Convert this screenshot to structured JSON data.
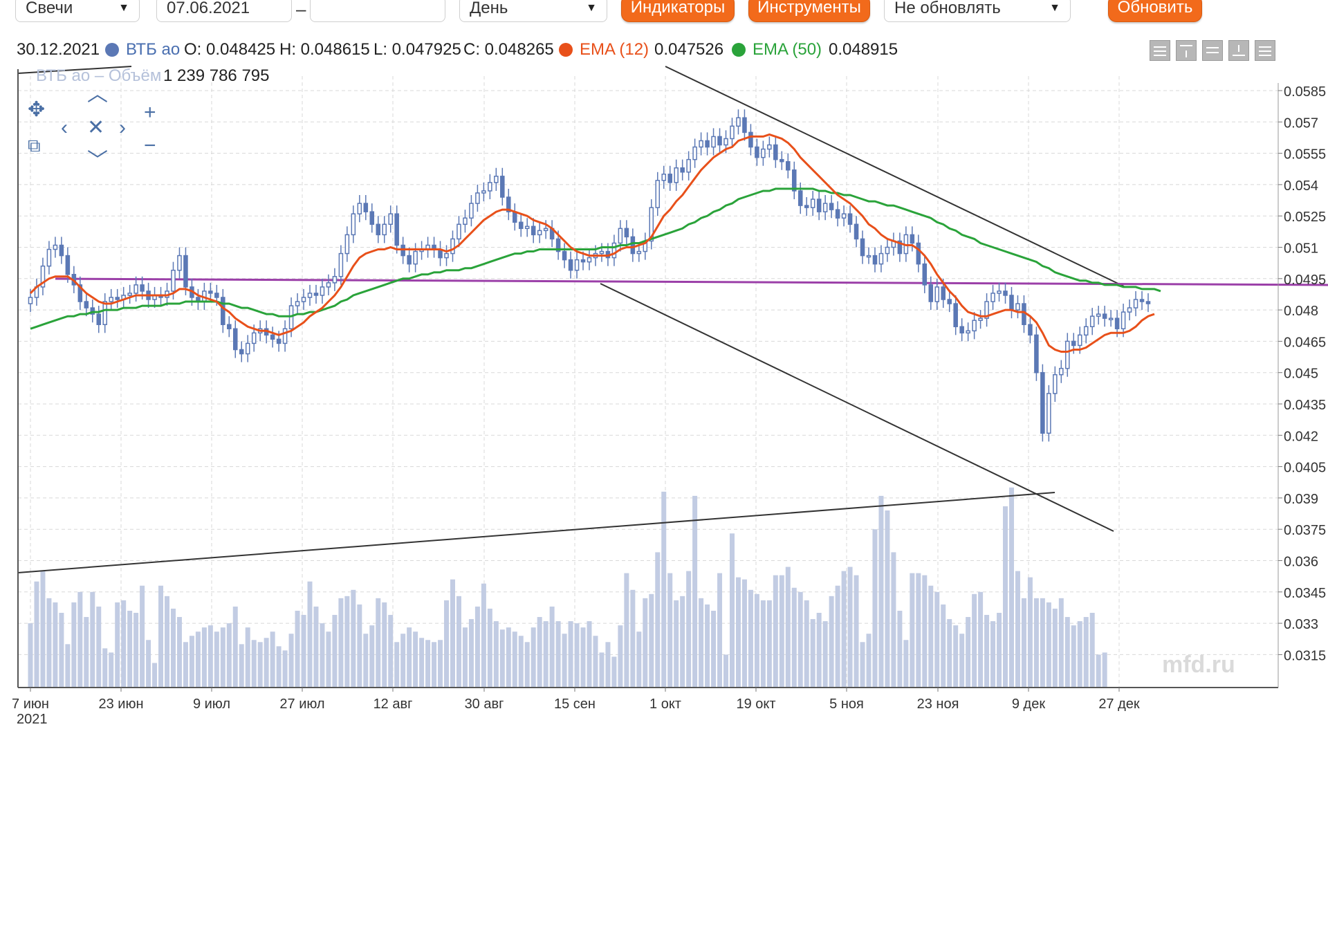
{
  "toolbar": {
    "chart_type": "Свечи",
    "date_from": "07.06.2021",
    "range_dash": "–",
    "date_to": "",
    "period": "День",
    "indicators_label": "Индикаторы",
    "instruments_label": "Инструменты",
    "refresh_mode": "Не обновлять",
    "refresh_label": "Обновить"
  },
  "legend": {
    "date": "30.12.2021",
    "instrument": "ВТБ ао",
    "open": "O: 0.048425",
    "high": "H: 0.048615",
    "low": "L: 0.047925",
    "close": "C: 0.048265",
    "ema12_label": "EMA (12)",
    "ema12_value": "0.047526",
    "ema50_label": "EMA (50)",
    "ema50_value": "0.048915",
    "volume_label": "ВТБ ао – Объём",
    "volume_value": "1 239 786 795"
  },
  "colors": {
    "candle": "#5b78b5",
    "ema12": "#e8501a",
    "ema50": "#2aa33a",
    "support": "#9b3fa8",
    "volume": "#c2cce3",
    "button": "#f26a1b"
  },
  "icons": {
    "zoom_tools": [
      "move-icon",
      "zoom-box-icon",
      "pan-up-icon",
      "pan-left-icon",
      "reset-icon",
      "pan-right-icon",
      "pan-down-icon",
      "zoom-in-icon",
      "zoom-out-icon"
    ],
    "side_tools": [
      "menu-icon",
      "upload-icon",
      "lines-icon",
      "download-icon",
      "list-icon"
    ]
  },
  "watermark": "mfd.ru",
  "chart_data": {
    "type": "candlestick",
    "title": "",
    "x_ticks": [
      "7 июн",
      "23 июн",
      "9 июл",
      "27 июл",
      "12 авг",
      "30 авг",
      "15 сен",
      "1 окт",
      "19 окт",
      "5 ноя",
      "23 ноя",
      "9 дек",
      "27 дек"
    ],
    "x_year_label": "2021",
    "y_ticks": [
      0.0585,
      0.057,
      0.0555,
      0.054,
      0.0525,
      0.051,
      0.0495,
      0.048,
      0.0465,
      0.045,
      0.0435,
      0.042,
      0.0405,
      0.039,
      0.0375,
      0.036,
      0.0345,
      0.033,
      0.0315
    ],
    "y_tick_labels": [
      "0.0585",
      "0.057",
      "0.0555",
      "0.054",
      "0.0525",
      "0.051",
      "0.0495",
      "0.048",
      "0.0465",
      "0.045",
      "0.0435",
      "0.042",
      "0.0405",
      "0.039",
      "0.0375",
      "0.036",
      "0.0345",
      "0.033",
      "0.0315"
    ],
    "ylim": [
      0.031,
      0.0597
    ],
    "grid": true,
    "close": [
      0.0486,
      0.0491,
      0.0501,
      0.0509,
      0.0511,
      0.0506,
      0.0497,
      0.0492,
      0.0484,
      0.0481,
      0.0478,
      0.0473,
      0.0484,
      0.0486,
      0.0485,
      0.0487,
      0.0488,
      0.0492,
      0.0489,
      0.0485,
      0.0487,
      0.0486,
      0.0489,
      0.0499,
      0.0506,
      0.0491,
      0.0486,
      0.0484,
      0.0489,
      0.0488,
      0.0486,
      0.0473,
      0.0471,
      0.0461,
      0.0459,
      0.0464,
      0.0469,
      0.0471,
      0.0468,
      0.0466,
      0.0464,
      0.0471,
      0.0482,
      0.0484,
      0.0486,
      0.0488,
      0.0487,
      0.0491,
      0.0493,
      0.0496,
      0.0507,
      0.0516,
      0.0526,
      0.0531,
      0.0527,
      0.0521,
      0.0516,
      0.0521,
      0.0526,
      0.0511,
      0.0506,
      0.0502,
      0.0508,
      0.0509,
      0.0511,
      0.0509,
      0.0505,
      0.0507,
      0.0514,
      0.0521,
      0.0524,
      0.0531,
      0.0536,
      0.0537,
      0.0541,
      0.0544,
      0.0534,
      0.0527,
      0.0522,
      0.0519,
      0.052,
      0.0516,
      0.0518,
      0.0519,
      0.0514,
      0.0508,
      0.0504,
      0.0499,
      0.0504,
      0.0503,
      0.0505,
      0.0507,
      0.0508,
      0.0505,
      0.0512,
      0.0519,
      0.0515,
      0.0507,
      0.0508,
      0.0513,
      0.0529,
      0.0542,
      0.0545,
      0.0541,
      0.0548,
      0.0546,
      0.0552,
      0.0558,
      0.0561,
      0.0558,
      0.0563,
      0.0559,
      0.0562,
      0.0568,
      0.0572,
      0.0565,
      0.0558,
      0.0553,
      0.0557,
      0.0559,
      0.0552,
      0.0551,
      0.0547,
      0.0537,
      0.053,
      0.0529,
      0.0533,
      0.0527,
      0.0531,
      0.0528,
      0.0524,
      0.0526,
      0.0521,
      0.0514,
      0.0506,
      0.0506,
      0.0502,
      0.0507,
      0.051,
      0.0513,
      0.0507,
      0.0516,
      0.0512,
      0.0502,
      0.0492,
      0.0484,
      0.0491,
      0.0485,
      0.0483,
      0.0472,
      0.0469,
      0.047,
      0.0475,
      0.0476,
      0.0484,
      0.0488,
      0.0489,
      0.0487,
      0.048,
      0.0483,
      0.0473,
      0.0468,
      0.045,
      0.0421,
      0.044,
      0.0449,
      0.0452,
      0.0465,
      0.0463,
      0.0468,
      0.0472,
      0.0477,
      0.0478,
      0.0476,
      0.0476,
      0.0471,
      0.0479,
      0.0481,
      0.0485,
      0.0484,
      0.0483
    ],
    "volume": [
      0.033,
      0.035,
      0.0355,
      0.0342,
      0.034,
      0.0335,
      0.032,
      0.034,
      0.0345,
      0.0333,
      0.0345,
      0.0338,
      0.0318,
      0.0316,
      0.034,
      0.0341,
      0.0336,
      0.0335,
      0.0348,
      0.0322,
      0.0311,
      0.0348,
      0.0343,
      0.0337,
      0.0333,
      0.0321,
      0.0324,
      0.0326,
      0.0328,
      0.0329,
      0.0326,
      0.0328,
      0.033,
      0.0338,
      0.032,
      0.0328,
      0.0322,
      0.0321,
      0.0323,
      0.0326,
      0.0319,
      0.0317,
      0.0325,
      0.0336,
      0.0334,
      0.035,
      0.0338,
      0.033,
      0.0326,
      0.0334,
      0.0342,
      0.0343,
      0.0346,
      0.0339,
      0.0325,
      0.0329,
      0.0342,
      0.034,
      0.0334,
      0.0321,
      0.0325,
      0.0328,
      0.0326,
      0.0323,
      0.0322,
      0.0321,
      0.0322,
      0.0341,
      0.0351,
      0.0343,
      0.0328,
      0.0332,
      0.0338,
      0.0349,
      0.0337,
      0.0331,
      0.0327,
      0.0328,
      0.0326,
      0.0324,
      0.0321,
      0.0328,
      0.0333,
      0.0331,
      0.0338,
      0.0331,
      0.0325,
      0.0331,
      0.033,
      0.0328,
      0.0331,
      0.0324,
      0.0316,
      0.0321,
      0.0314,
      0.0329,
      0.0354,
      0.0346,
      0.0326,
      0.0342,
      0.0344,
      0.0364,
      0.0393,
      0.0354,
      0.0341,
      0.0343,
      0.0355,
      0.0391,
      0.0342,
      0.0339,
      0.0336,
      0.0354,
      0.0315,
      0.0373,
      0.0352,
      0.0351,
      0.0346,
      0.0344,
      0.0341,
      0.0341,
      0.0353,
      0.0353,
      0.0357,
      0.0347,
      0.0345,
      0.0341,
      0.0332,
      0.0335,
      0.0331,
      0.0343,
      0.0348,
      0.0355,
      0.0357,
      0.0353,
      0.0321,
      0.0325,
      0.0375,
      0.0391,
      0.0384,
      0.0364,
      0.0336,
      0.0322,
      0.0354,
      0.0354,
      0.0353,
      0.0348,
      0.0345,
      0.0339,
      0.0332,
      0.0329,
      0.0325,
      0.0333,
      0.0344,
      0.0345,
      0.0334,
      0.0331,
      0.0335,
      0.0386,
      0.0395,
      0.0355,
      0.0342,
      0.0352,
      0.0342,
      0.0342,
      0.034,
      0.0337,
      0.0342,
      0.0333,
      0.0329,
      0.0331,
      0.0333,
      0.0335,
      0.0315,
      0.0316
    ],
    "ema12": [
      0.0488,
      0.0491,
      0.0493,
      0.0495,
      0.0496,
      0.0496,
      0.0496,
      0.0494,
      0.0491,
      0.0488,
      0.0486,
      0.0484,
      0.0483,
      0.0483,
      0.0484,
      0.0485,
      0.0486,
      0.0487,
      0.0487,
      0.0487,
      0.0487,
      0.0487,
      0.0487,
      0.0488,
      0.049,
      0.049,
      0.0489,
      0.0487,
      0.0486,
      0.0485,
      0.0484,
      0.0481,
      0.0479,
      0.0476,
      0.0474,
      0.0472,
      0.0471,
      0.047,
      0.047,
      0.0469,
      0.0468,
      0.0469,
      0.047,
      0.0472,
      0.0474,
      0.0477,
      0.0479,
      0.0481,
      0.0484,
      0.0487,
      0.0491,
      0.0496,
      0.0501,
      0.0505,
      0.0507,
      0.0508,
      0.0509,
      0.0509,
      0.051,
      0.0509,
      0.0509,
      0.0509,
      0.0509,
      0.0509,
      0.0509,
      0.0509,
      0.0509,
      0.0508,
      0.0509,
      0.0511,
      0.0514,
      0.0517,
      0.052,
      0.0523,
      0.0525,
      0.0527,
      0.0528,
      0.0528,
      0.0527,
      0.0526,
      0.0525,
      0.0523,
      0.0522,
      0.0521,
      0.0519,
      0.0516,
      0.0513,
      0.051,
      0.0508,
      0.0507,
      0.0506,
      0.0506,
      0.0506,
      0.0506,
      0.0507,
      0.0509,
      0.051,
      0.051,
      0.0511,
      0.0512,
      0.0515,
      0.052,
      0.0525,
      0.0528,
      0.0532,
      0.0535,
      0.0539,
      0.0543,
      0.0547,
      0.055,
      0.0553,
      0.0555,
      0.0557,
      0.0558,
      0.0561,
      0.0562,
      0.0563,
      0.0563,
      0.0563,
      0.0564,
      0.0563,
      0.0562,
      0.056,
      0.0557,
      0.0553,
      0.055,
      0.0547,
      0.0544,
      0.0541,
      0.0538,
      0.0535,
      0.0533,
      0.0531,
      0.0528,
      0.0525,
      0.0521,
      0.0519,
      0.0516,
      0.0514,
      0.0513,
      0.0512,
      0.0511,
      0.0511,
      0.0509,
      0.0506,
      0.0502,
      0.0497,
      0.0493,
      0.0489,
      0.0486,
      0.0482,
      0.0479,
      0.0478,
      0.0477,
      0.0477,
      0.0478,
      0.0479,
      0.048,
      0.048,
      0.0479,
      0.0479,
      0.0477,
      0.0474,
      0.0469,
      0.0463,
      0.0461,
      0.046,
      0.046,
      0.0461,
      0.0461,
      0.0462,
      0.0464,
      0.0466,
      0.0468,
      0.0469,
      0.0469,
      0.0469,
      0.047,
      0.0472,
      0.0475,
      0.0477,
      0.0478
    ],
    "ema50": [
      0.0471,
      0.0472,
      0.0473,
      0.0474,
      0.0475,
      0.0476,
      0.0477,
      0.0477,
      0.0478,
      0.0478,
      0.0479,
      0.0479,
      0.048,
      0.048,
      0.048,
      0.0481,
      0.0481,
      0.0481,
      0.0482,
      0.0482,
      0.0482,
      0.0482,
      0.0483,
      0.0483,
      0.0483,
      0.0484,
      0.0484,
      0.0484,
      0.0484,
      0.0484,
      0.0484,
      0.0483,
      0.0483,
      0.0482,
      0.0481,
      0.0481,
      0.048,
      0.0479,
      0.0478,
      0.0478,
      0.0477,
      0.0477,
      0.0477,
      0.0478,
      0.0478,
      0.0479,
      0.0479,
      0.048,
      0.0481,
      0.0482,
      0.0484,
      0.0485,
      0.0487,
      0.0488,
      0.0489,
      0.049,
      0.0491,
      0.0492,
      0.0493,
      0.0494,
      0.0495,
      0.0495,
      0.0496,
      0.0497,
      0.0497,
      0.0498,
      0.0498,
      0.0499,
      0.0499,
      0.0499,
      0.05,
      0.05,
      0.0501,
      0.0502,
      0.0503,
      0.0504,
      0.0505,
      0.0506,
      0.0507,
      0.0507,
      0.0508,
      0.0508,
      0.0509,
      0.0509,
      0.0509,
      0.0509,
      0.0509,
      0.0509,
      0.0509,
      0.0509,
      0.0509,
      0.0509,
      0.051,
      0.051,
      0.051,
      0.0511,
      0.0511,
      0.0512,
      0.0512,
      0.0513,
      0.0514,
      0.0515,
      0.0516,
      0.0517,
      0.0518,
      0.0519,
      0.0521,
      0.0522,
      0.0524,
      0.0525,
      0.0527,
      0.0528,
      0.053,
      0.0531,
      0.0533,
      0.0534,
      0.0535,
      0.0536,
      0.0537,
      0.0537,
      0.0538,
      0.0538,
      0.0538,
      0.0538,
      0.0538,
      0.0538,
      0.0538,
      0.0537,
      0.0537,
      0.0536,
      0.0536,
      0.0535,
      0.0535,
      0.0534,
      0.0533,
      0.0532,
      0.0532,
      0.0531,
      0.053,
      0.053,
      0.0529,
      0.0528,
      0.0527,
      0.0526,
      0.0525,
      0.0524,
      0.0522,
      0.0521,
      0.0519,
      0.0518,
      0.0516,
      0.0515,
      0.0514,
      0.0512,
      0.0511,
      0.051,
      0.0509,
      0.0508,
      0.0507,
      0.0506,
      0.0505,
      0.0504,
      0.0503,
      0.0501,
      0.05,
      0.0498,
      0.0497,
      0.0496,
      0.0495,
      0.0494,
      0.0494,
      0.0493,
      0.0493,
      0.0492,
      0.0492,
      0.0492,
      0.0491,
      0.0491,
      0.0491,
      0.049,
      0.049,
      0.049,
      0.0489
    ]
  }
}
